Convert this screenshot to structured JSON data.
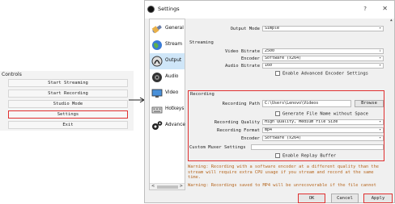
{
  "controls": {
    "title": "Controls",
    "buttons": [
      {
        "label": "Start Streaming"
      },
      {
        "label": "Start Recording"
      },
      {
        "label": "Studio Mode"
      },
      {
        "label": "Settings"
      },
      {
        "label": "Exit"
      }
    ],
    "highlight_color": "#e03030"
  },
  "window": {
    "title": "Settings",
    "help": "?",
    "close": "✕"
  },
  "sidebar": {
    "items": [
      {
        "label": "General",
        "icon": "wrench-icon"
      },
      {
        "label": "Stream",
        "icon": "globe-icon"
      },
      {
        "label": "Output",
        "icon": "output-icon"
      },
      {
        "label": "Audio",
        "icon": "speaker-icon"
      },
      {
        "label": "Video",
        "icon": "monitor-icon"
      },
      {
        "label": "Hotkeys",
        "icon": "keyboard-icon"
      },
      {
        "label": "Advance",
        "icon": "gears-icon"
      }
    ],
    "active_index": 2,
    "scroll_left": "<",
    "scroll_right": ">"
  },
  "output": {
    "mode_label": "Output Mode",
    "mode_value": "Simple",
    "streaming_section": "Streaming",
    "video_bitrate_label": "Video Bitrate",
    "video_bitrate_value": "2500",
    "encoder_label": "Encoder",
    "encoder_value": "Software (x264)",
    "audio_bitrate_label": "Audio Bitrate",
    "audio_bitrate_value": "160",
    "advanced_encoder_label": "Enable Advanced Encoder Settings",
    "recording_section": "Recording",
    "recording_path_label": "Recording Path",
    "recording_path_value": "C:\\Users\\Lenovo\\Videos",
    "browse_label": "Browse",
    "generate_filename_label": "Generate File Name without Space",
    "recording_quality_label": "Recording Quality",
    "recording_quality_value": "High Quality, Medium File Size",
    "recording_format_label": "Recording Format",
    "recording_format_value": "mp4",
    "rec_encoder_label": "Encoder",
    "rec_encoder_value": "Software (x264)",
    "custom_muxer_label": "Custom Muxer Settings",
    "custom_muxer_value": "",
    "replay_buffer_label": "Enable Replay Buffer",
    "warning1": "Warning: Recording with a software encoder at a different quality than the stream will require extra CPU usage if you stream and record at the same time.",
    "warning2": "Warning: Recordings saved to MP4 will be unrecoverable if the file cannot"
  },
  "footer": {
    "ok": "OK",
    "cancel": "Cancel",
    "apply": "Apply"
  }
}
